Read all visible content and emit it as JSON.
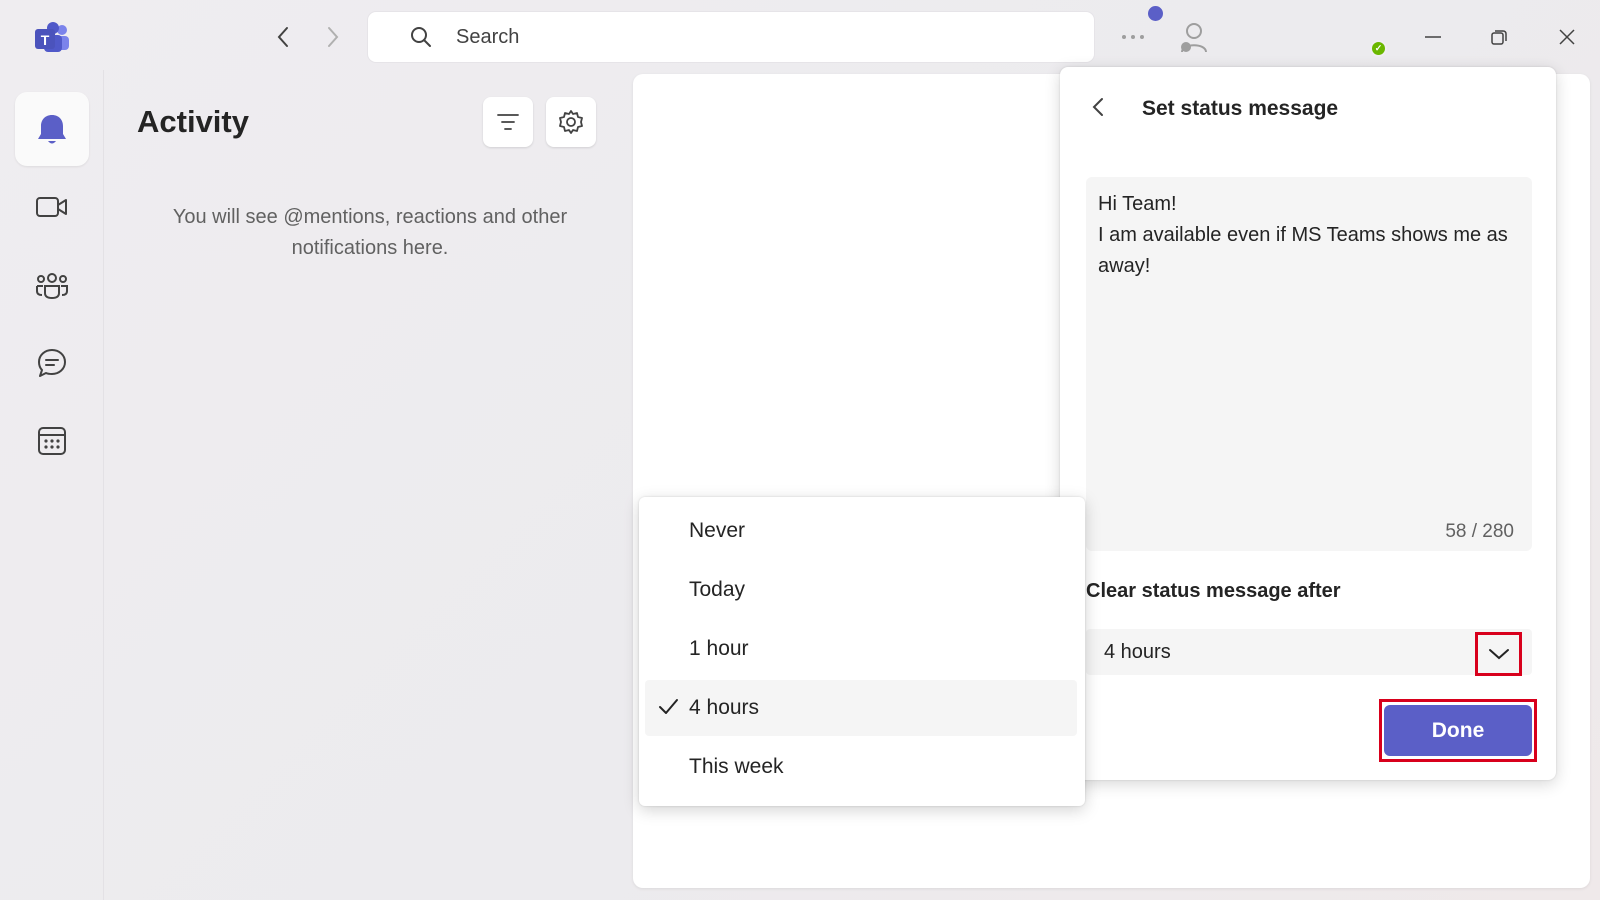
{
  "titlebar": {
    "search_placeholder": "Search",
    "icons": {
      "logo": "teams-logo-icon",
      "back": "chevron-left-icon",
      "forward": "chevron-right-icon",
      "search": "search-icon",
      "more": "more-icon",
      "profile": "person-icon",
      "minimize": "minimize-icon",
      "restore": "restore-icon",
      "close": "close-icon"
    },
    "colors": {
      "accent": "#5b5fc7",
      "presence": "#6bb700"
    }
  },
  "rail": {
    "items": [
      {
        "icon": "bell-icon",
        "active": true
      },
      {
        "icon": "video-icon",
        "active": false
      },
      {
        "icon": "people-icon",
        "active": false
      },
      {
        "icon": "chat-icon",
        "active": false
      },
      {
        "icon": "calendar-icon",
        "active": false
      }
    ]
  },
  "activity": {
    "title": "Activity",
    "empty_message": "You will see @mentions, reactions and other notifications here."
  },
  "status_panel": {
    "title": "Set status message",
    "message": "Hi Team!\nI am available even if MS Teams shows me as away!",
    "char_count": "58 / 280",
    "clear_label": "Clear status message after",
    "clear_value": "4 hours",
    "done_label": "Done"
  },
  "dropdown": {
    "options": [
      "Never",
      "Today",
      "1 hour",
      "4 hours",
      "This week"
    ],
    "selected": "4 hours"
  },
  "highlight_color": "#d8001c"
}
